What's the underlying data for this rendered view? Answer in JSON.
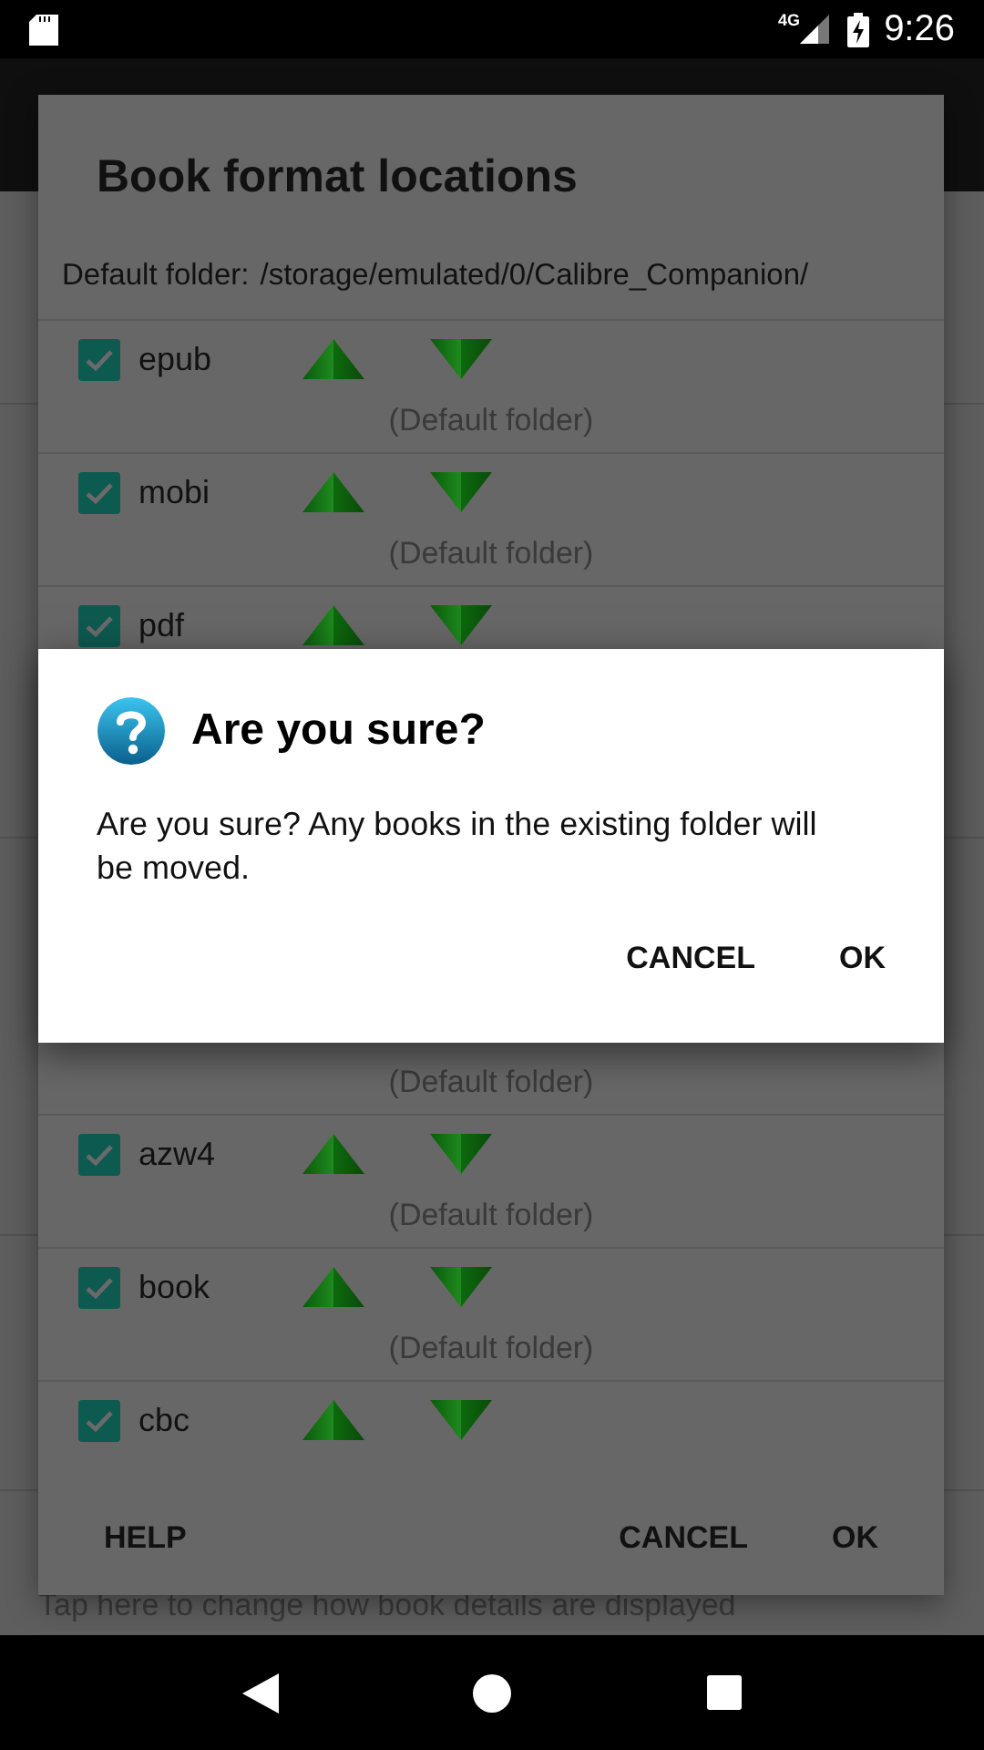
{
  "status_bar": {
    "network": "4G",
    "time": "9:26"
  },
  "background": {
    "hint": "Tap here to change how book details are displayed"
  },
  "format_dialog": {
    "title": "Book format locations",
    "default_folder_label": "Default folder:",
    "default_folder_path": "/storage/emulated/0/Calibre_Companion/",
    "rows_top": [
      {
        "name": "epub",
        "checked": true,
        "folder": "(Default folder)"
      },
      {
        "name": "mobi",
        "checked": true,
        "folder": "(Default folder)"
      },
      {
        "name": "pdf",
        "checked": true
      }
    ],
    "rows_bottom": [
      {
        "folder": "(Default folder)"
      },
      {
        "name": "azw4",
        "checked": true,
        "folder": "(Default folder)"
      },
      {
        "name": "book",
        "checked": true,
        "folder": "(Default folder)"
      },
      {
        "name": "cbc",
        "checked": true
      }
    ],
    "help_button": "HELP",
    "buttons": [
      "CANCEL",
      "OK"
    ]
  },
  "confirm_dialog": {
    "title": "Are you sure?",
    "message": "Are you sure? Any books in the existing folder will be moved.",
    "buttons": [
      "CANCEL",
      "OK"
    ]
  }
}
